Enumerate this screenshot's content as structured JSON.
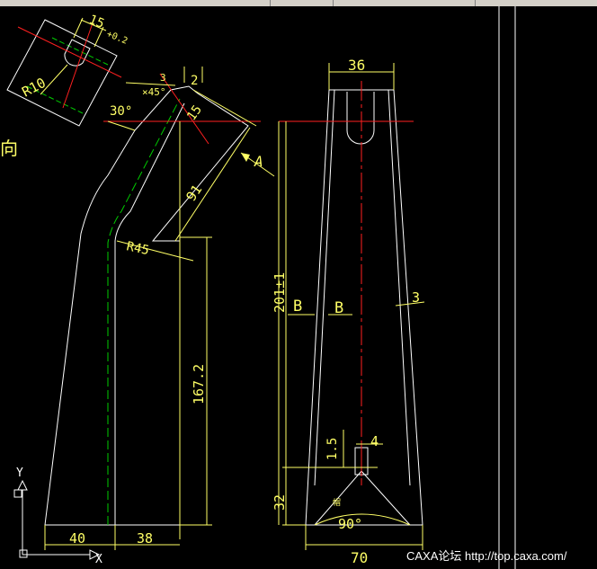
{
  "window": {
    "titlebar_color": "#d4d0c8",
    "background": "#000000"
  },
  "colors": {
    "outline": "#ffffff",
    "dimension": "#ffff66",
    "centerline": "#ff2020",
    "hidden_line": "#00cc00",
    "axis": "#ffffff"
  },
  "annotations": {
    "top_width": "15",
    "top_tol": "+0.2",
    "radius_small": "R10",
    "chamfer_3": "3",
    "chamfer_x45": "×45°",
    "dim_2": "2",
    "angle_30": "30°",
    "dim_15": "15",
    "view_A": "A",
    "dim_91": "91",
    "radius_R45": "R45",
    "dim_167": "167.2",
    "dim_40": "40",
    "dim_38": "38",
    "partial_label": "向",
    "axis_y": "Y",
    "axis_x": "X",
    "dim_36": "36",
    "dim_201": "201±1",
    "section_B_left": "B",
    "section_B_right": "B",
    "dim_3": "3",
    "dim_1_5": "1.5",
    "dim_4": "4",
    "dim_32": "32",
    "angle_90": "90°",
    "dim_70": "70",
    "small_mark": "帽"
  },
  "watermark": "CAXA论坛 http://top.caxa.com/"
}
